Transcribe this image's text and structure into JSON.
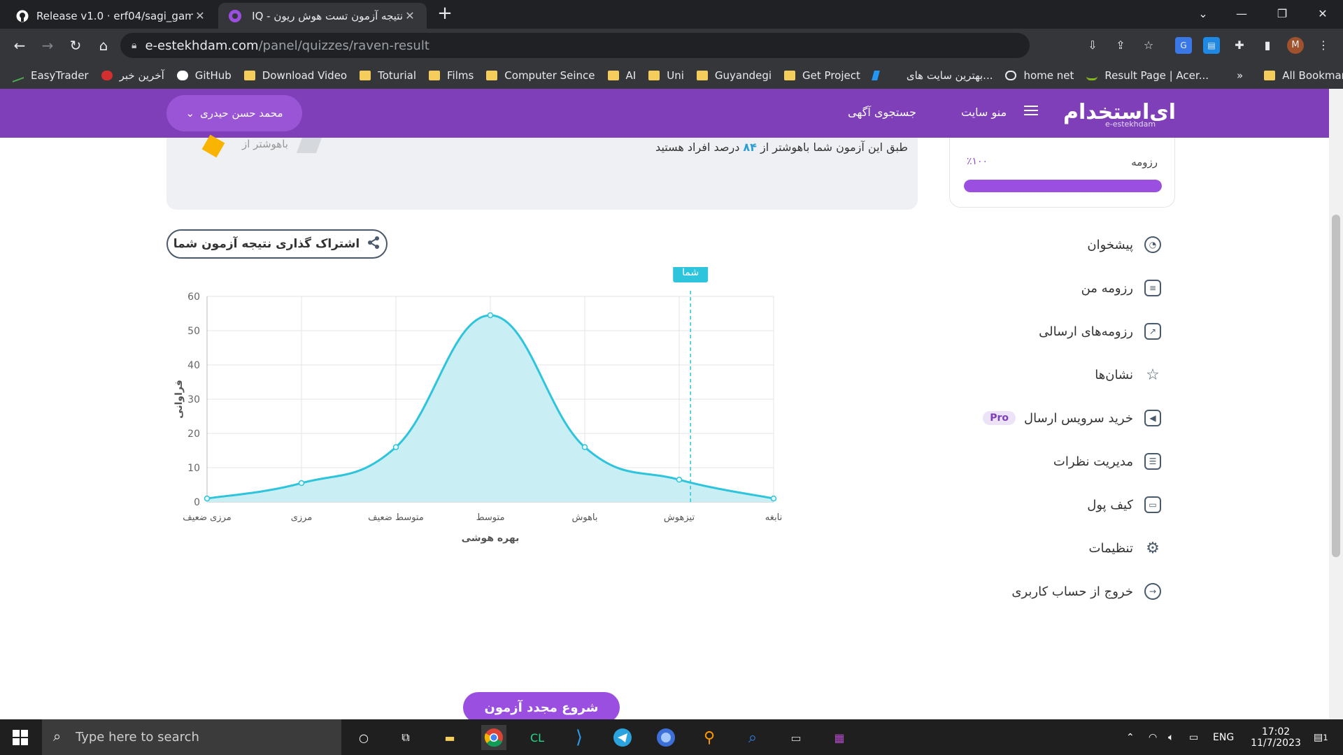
{
  "browser": {
    "tabs": [
      {
        "title": "Release v1.0 · erf04/sagi_games",
        "close": "✕"
      },
      {
        "title": "نتیجه آزمون تست هوش ریون - IQ",
        "close": "✕"
      }
    ],
    "new_tab": "+",
    "url_host": "e-estekhdam.com",
    "url_path": "/panel/quizzes/raven-result",
    "profile_initial": "M",
    "bookmarks": [
      {
        "label": "EasyTrader",
        "icon": "chart-icon"
      },
      {
        "label": "آخرین خبر",
        "icon": "news-icon"
      },
      {
        "label": "GitHub",
        "icon": "github-icon"
      },
      {
        "label": "Download Video",
        "icon": "folder-icon"
      },
      {
        "label": "Toturial",
        "icon": "folder-icon"
      },
      {
        "label": "Films",
        "icon": "folder-icon"
      },
      {
        "label": "Computer Seince",
        "icon": "folder-icon"
      },
      {
        "label": "AI",
        "icon": "folder-icon"
      },
      {
        "label": "Uni",
        "icon": "folder-icon"
      },
      {
        "label": "Guyandegi",
        "icon": "folder-icon"
      },
      {
        "label": "Get Project",
        "icon": "folder-icon"
      },
      {
        "label": "بهترین سایت های...",
        "icon": "site-icon"
      },
      {
        "label": "home net",
        "icon": "globe-icon"
      },
      {
        "label": "Result Page | Acer...",
        "icon": "acer-icon"
      }
    ],
    "bookmarks_more": "»",
    "all_bookmarks": "All Bookmarks"
  },
  "site": {
    "logo": "ای‌استخدام",
    "logo_sub": "e-estekhdam",
    "menu_label": "منو سایت",
    "search_jobs": "جستجوی آگهی",
    "user_name": "محمد حسن حیدری",
    "brand_color": "#7e3fb9"
  },
  "result": {
    "text_before": "طبق این آزمون شما باهوشتر از",
    "percent": "۸۴",
    "text_after": "درصد افراد هستید",
    "badge_label": "باهوشتر از"
  },
  "resume": {
    "label": "رزومه",
    "percent_text": "٪۱۰۰",
    "progress": 1.0
  },
  "share_label": "اشتراک گذاری نتیجه آزمون شما",
  "sidebar": {
    "items": [
      {
        "label": "پیشخوان",
        "icon": "dashboard-icon"
      },
      {
        "label": "رزومه من",
        "icon": "document-icon"
      },
      {
        "label": "رزومه‌های ارسالی",
        "icon": "send-icon"
      },
      {
        "label": "نشان‌ها",
        "icon": "star-icon"
      },
      {
        "label": "خرید سرویس ارسال",
        "icon": "megaphone-icon",
        "badge": "Pro"
      },
      {
        "label": "مدیریت نظرات",
        "icon": "comment-icon"
      },
      {
        "label": "کیف پول",
        "icon": "wallet-icon"
      },
      {
        "label": "تنظیمات",
        "icon": "gear-icon"
      },
      {
        "label": "خروج از حساب کاربری",
        "icon": "logout-icon"
      }
    ]
  },
  "chart_data": {
    "type": "area",
    "categories": [
      "مرزی ضعیف",
      "مرزی",
      "متوسط ضعیف",
      "متوسط",
      "باهوش",
      "تیزهوش",
      "نابغه"
    ],
    "values": [
      1,
      5.5,
      16,
      54.5,
      16,
      6.5,
      1
    ],
    "xlabel": "بهره هوشی",
    "ylabel": "فراوانی",
    "ylim": [
      0,
      60
    ],
    "yticks": [
      0,
      10,
      20,
      30,
      40,
      50,
      60
    ],
    "grid": true,
    "marker_label": "شما",
    "marker_x": 5.12,
    "line_color": "#2ec5dc",
    "fill_color": "#c9eef4"
  },
  "restart_label": "شروع مجدد آزمون",
  "taskbar": {
    "search_placeholder": "Type here to search",
    "lang": "ENG",
    "time": "17:02",
    "date": "11/7/2023",
    "notification_count": "1"
  }
}
